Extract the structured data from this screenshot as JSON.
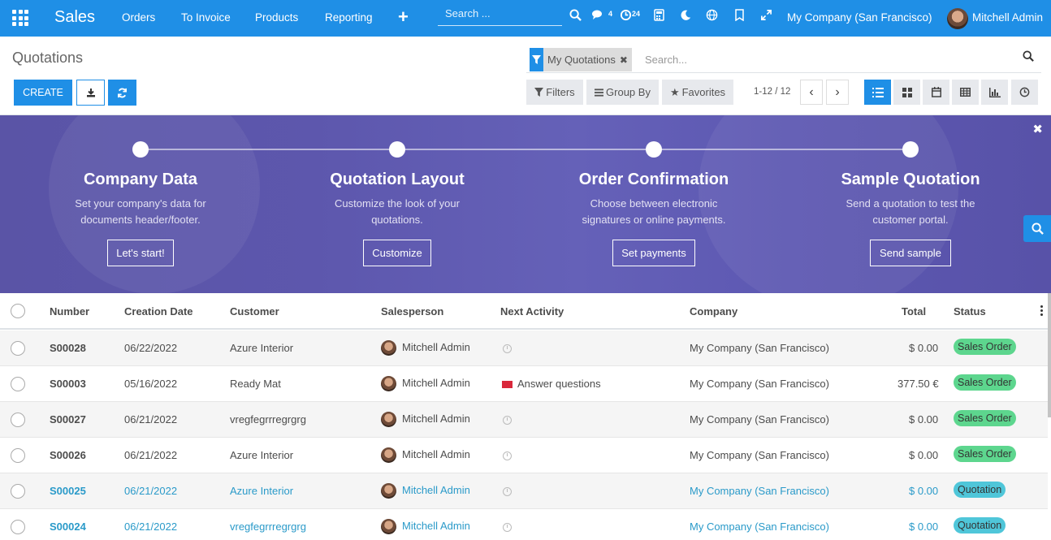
{
  "nav": {
    "app_name": "Sales",
    "menus": [
      "Orders",
      "To Invoice",
      "Products",
      "Reporting"
    ],
    "search_placeholder": "Search ...",
    "messages_count": "4",
    "activities_count": "24",
    "company": "My Company (San Francisco)",
    "user": "Mitchell Admin",
    "brand_color": "#1f8fe6"
  },
  "control": {
    "title": "Quotations",
    "create_label": "CREATE",
    "facet_label": "My Quotations",
    "search_placeholder": "Search...",
    "filters_label": "Filters",
    "groupby_label": "Group By",
    "favorites_label": "Favorites",
    "pager": "1-12 / 12"
  },
  "banner": {
    "steps": [
      {
        "title": "Company Data",
        "line1": "Set your company's data for",
        "line2": "documents header/footer.",
        "button": "Let's start!"
      },
      {
        "title": "Quotation Layout",
        "line1": "Customize the look of your",
        "line2": "quotations.",
        "button": "Customize"
      },
      {
        "title": "Order Confirmation",
        "line1": "Choose between electronic",
        "line2": "signatures or online payments.",
        "button": "Set payments"
      },
      {
        "title": "Sample Quotation",
        "line1": "Send a quotation to test the",
        "line2": "customer portal.",
        "button": "Send sample"
      }
    ]
  },
  "table": {
    "headers": {
      "number": "Number",
      "date": "Creation Date",
      "customer": "Customer",
      "salesperson": "Salesperson",
      "activity": "Next Activity",
      "company": "Company",
      "total": "Total",
      "status": "Status"
    },
    "rows": [
      {
        "number": "S00028",
        "date": "06/22/2022",
        "customer": "Azure Interior",
        "salesperson": "Mitchell Admin",
        "activity": "",
        "company": "My Company (San Francisco)",
        "total": "$ 0.00",
        "status": "Sales Order"
      },
      {
        "number": "S00003",
        "date": "05/16/2022",
        "customer": "Ready Mat",
        "salesperson": "Mitchell Admin",
        "activity": "Answer questions",
        "company": "My Company (San Francisco)",
        "total": "377.50 €",
        "status": "Sales Order"
      },
      {
        "number": "S00027",
        "date": "06/21/2022",
        "customer": "vregfegrrregrgrg",
        "salesperson": "Mitchell Admin",
        "activity": "",
        "company": "My Company (San Francisco)",
        "total": "$ 0.00",
        "status": "Sales Order"
      },
      {
        "number": "S00026",
        "date": "06/21/2022",
        "customer": "Azure Interior",
        "salesperson": "Mitchell Admin",
        "activity": "",
        "company": "My Company (San Francisco)",
        "total": "$ 0.00",
        "status": "Sales Order"
      },
      {
        "number": "S00025",
        "date": "06/21/2022",
        "customer": "Azure Interior",
        "salesperson": "Mitchell Admin",
        "activity": "",
        "company": "My Company (San Francisco)",
        "total": "$ 0.00",
        "status": "Quotation"
      },
      {
        "number": "S00024",
        "date": "06/21/2022",
        "customer": "vregfegrrregrgrg",
        "salesperson": "Mitchell Admin",
        "activity": "",
        "company": "My Company (San Francisco)",
        "total": "$ 0.00",
        "status": "Quotation"
      }
    ]
  }
}
